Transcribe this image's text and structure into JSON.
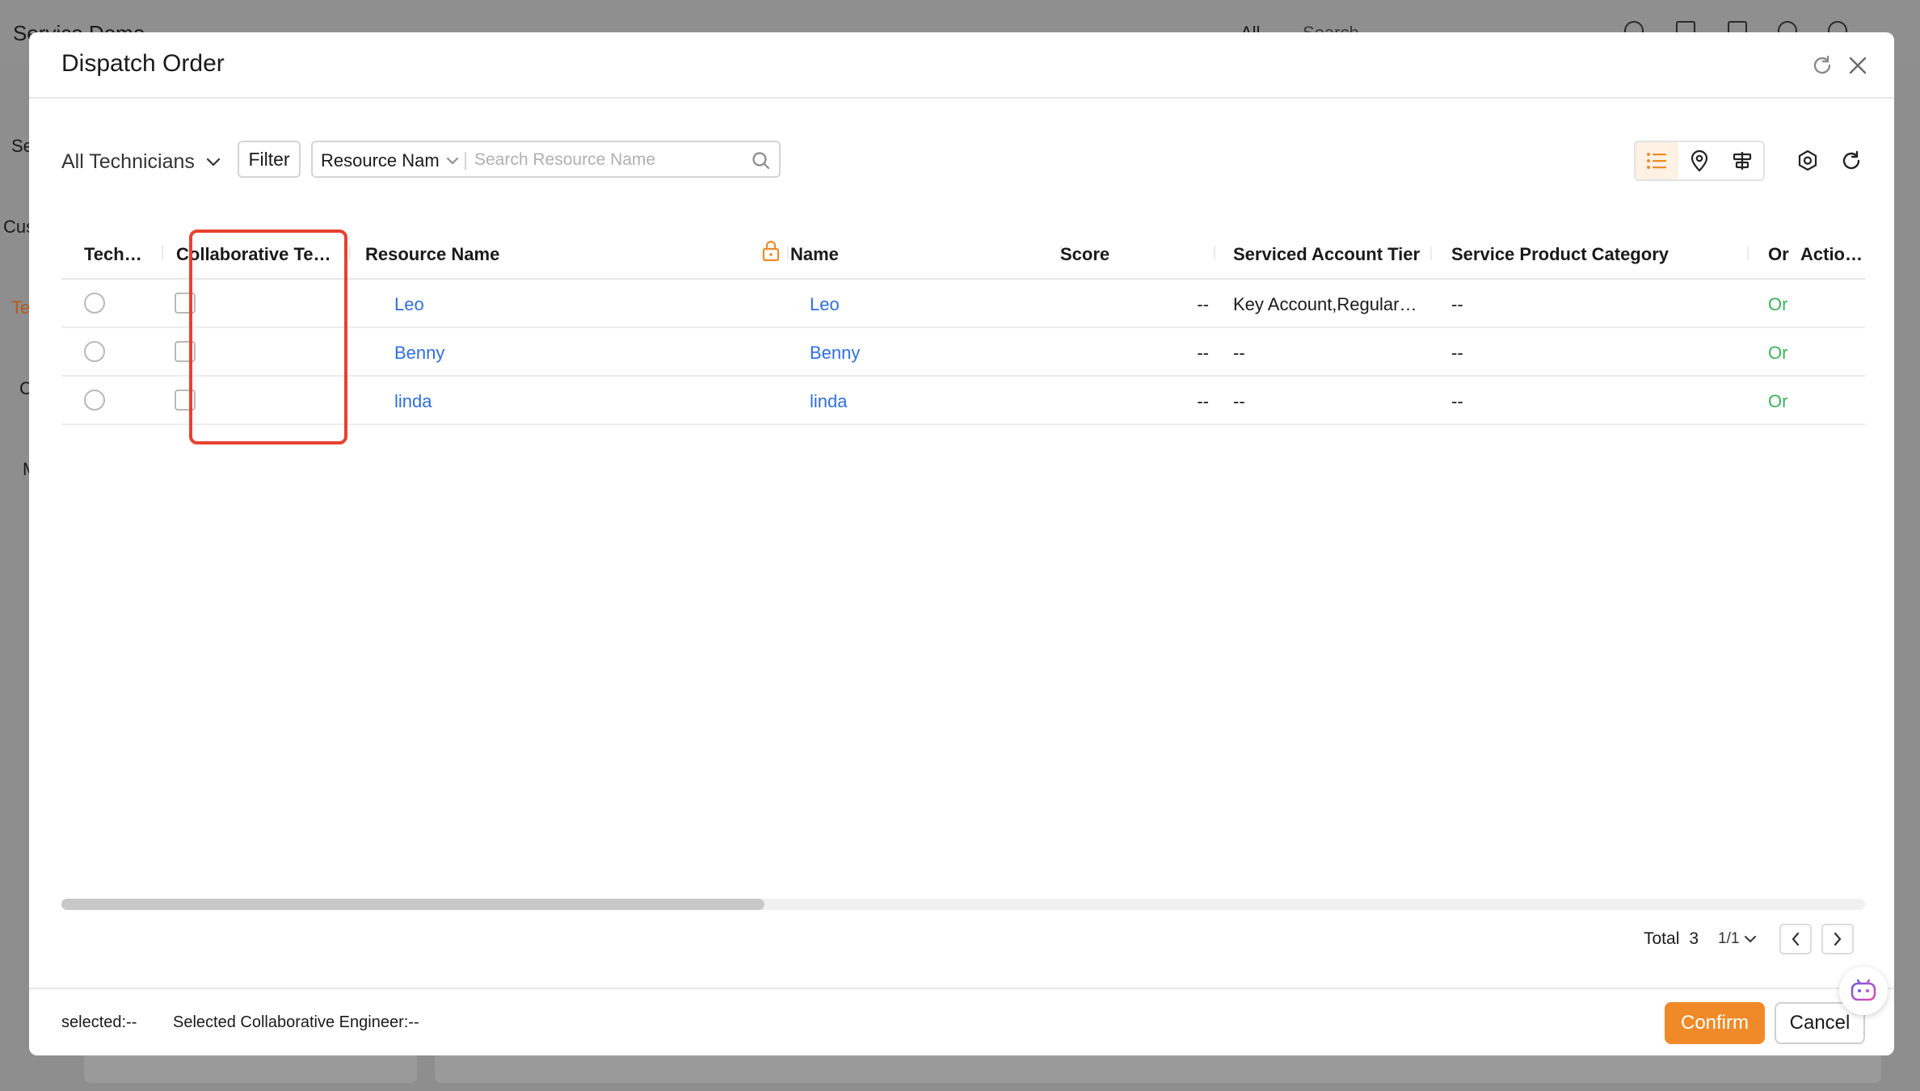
{
  "background_app": {
    "title": "Service Demo",
    "scope": "All",
    "search_placeholder": "Search",
    "sidebar_fragments": [
      "Se",
      "Cus",
      "Te",
      "C",
      "M"
    ]
  },
  "modal": {
    "title": "Dispatch Order",
    "refresh_icon": "refresh-icon",
    "close_icon": "close-icon"
  },
  "toolbar": {
    "scope_label": "All Technicians",
    "filter_label": "Filter",
    "search_field": "Resource Nam",
    "search_placeholder": "Search Resource Name",
    "views": [
      "list-view-icon",
      "map-view-icon",
      "gantt-view-icon"
    ],
    "active_view": "list-view-icon"
  },
  "table": {
    "columns": {
      "technician": "Tech…",
      "collaborative": "Collaborative Te…",
      "resource_name": "Resource Name",
      "name": "Name",
      "score": "Score",
      "serviced_account_tier": "Serviced Account Tier",
      "service_product_category": "Service Product Category",
      "or": "Or",
      "actions": "Actions"
    },
    "rows": [
      {
        "resource_name": "Leo",
        "name": "Leo",
        "score": "--",
        "serviced_account_tier": "Key Account,Regular …",
        "service_product_category": "--",
        "status": "Or"
      },
      {
        "resource_name": "Benny",
        "name": "Benny",
        "score": "--",
        "serviced_account_tier": "--",
        "service_product_category": "--",
        "status": "Or"
      },
      {
        "resource_name": "linda",
        "name": "linda",
        "score": "--",
        "serviced_account_tier": "--",
        "service_product_category": "--",
        "status": "Or"
      }
    ],
    "horizontal_scroll_fraction": 0.39
  },
  "pagination": {
    "total_label": "Total",
    "total": "3",
    "page": "1/1"
  },
  "footer": {
    "selected_label": "selected:--",
    "collab_label": "Selected Collaborative Engineer:--",
    "confirm_label": "Confirm",
    "cancel_label": "Cancel"
  },
  "colors": {
    "accent": "#f08a28",
    "link": "#2f6fe0",
    "status": "#3cb35b",
    "highlight": "#e8412f"
  }
}
